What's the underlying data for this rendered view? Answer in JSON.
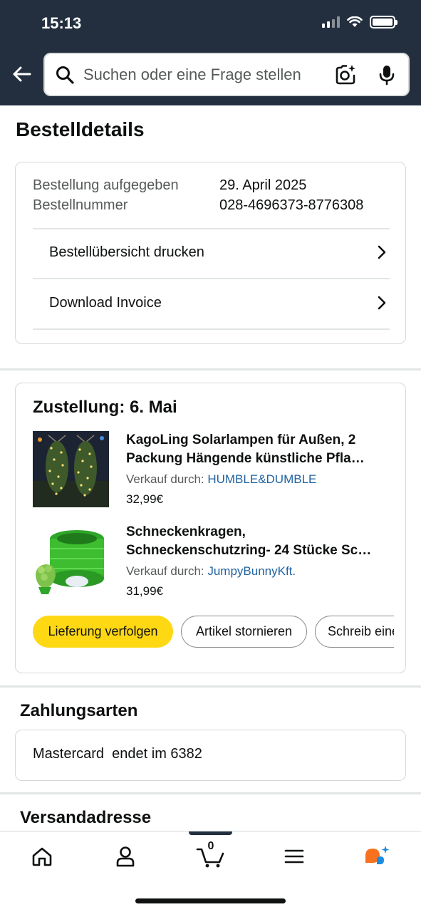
{
  "status_bar": {
    "time": "15:13"
  },
  "search": {
    "placeholder": "Suchen oder eine Frage stellen"
  },
  "page": {
    "title": "Bestelldetails"
  },
  "order_info": {
    "placed_label": "Bestellung aufgegeben",
    "placed_value": "29. April 2025",
    "number_label": "Bestellnummer",
    "number_value": "028-4696373-8776308",
    "print_summary": "Bestellübersicht drucken",
    "download_invoice": "Download Invoice"
  },
  "delivery": {
    "title": "Zustellung: 6. Mai",
    "items": [
      {
        "title_line1": "KagoLing Solarlampen für Außen, 2",
        "title_line2": "Packung Hängende künstliche Pfla…",
        "seller_label": "Verkauf durch: ",
        "seller": "HUMBLE&DUMBLE",
        "price": "32,99€"
      },
      {
        "title_line1": "Schneckenkragen,",
        "title_line2": "Schneckenschutzring- 24 Stücke Sc…",
        "seller_label": "Verkauf durch: ",
        "seller": "JumpyBunnyKft.",
        "price": "31,99€"
      }
    ],
    "buttons": {
      "track": "Lieferung verfolgen",
      "cancel": "Artikel stornieren",
      "review": "Schreib eine"
    }
  },
  "payment": {
    "title": "Zahlungsarten",
    "method": "Mastercard  endet im 6382"
  },
  "shipping": {
    "title": "Versandadresse"
  },
  "bottom_nav": {
    "cart_count": "0"
  },
  "colors": {
    "header_bg": "#232f3e",
    "accent_yellow": "#ffd814",
    "link_blue": "#2162a1",
    "assistant_orange": "#f7711e",
    "assistant_blue": "#1d8ce0"
  }
}
